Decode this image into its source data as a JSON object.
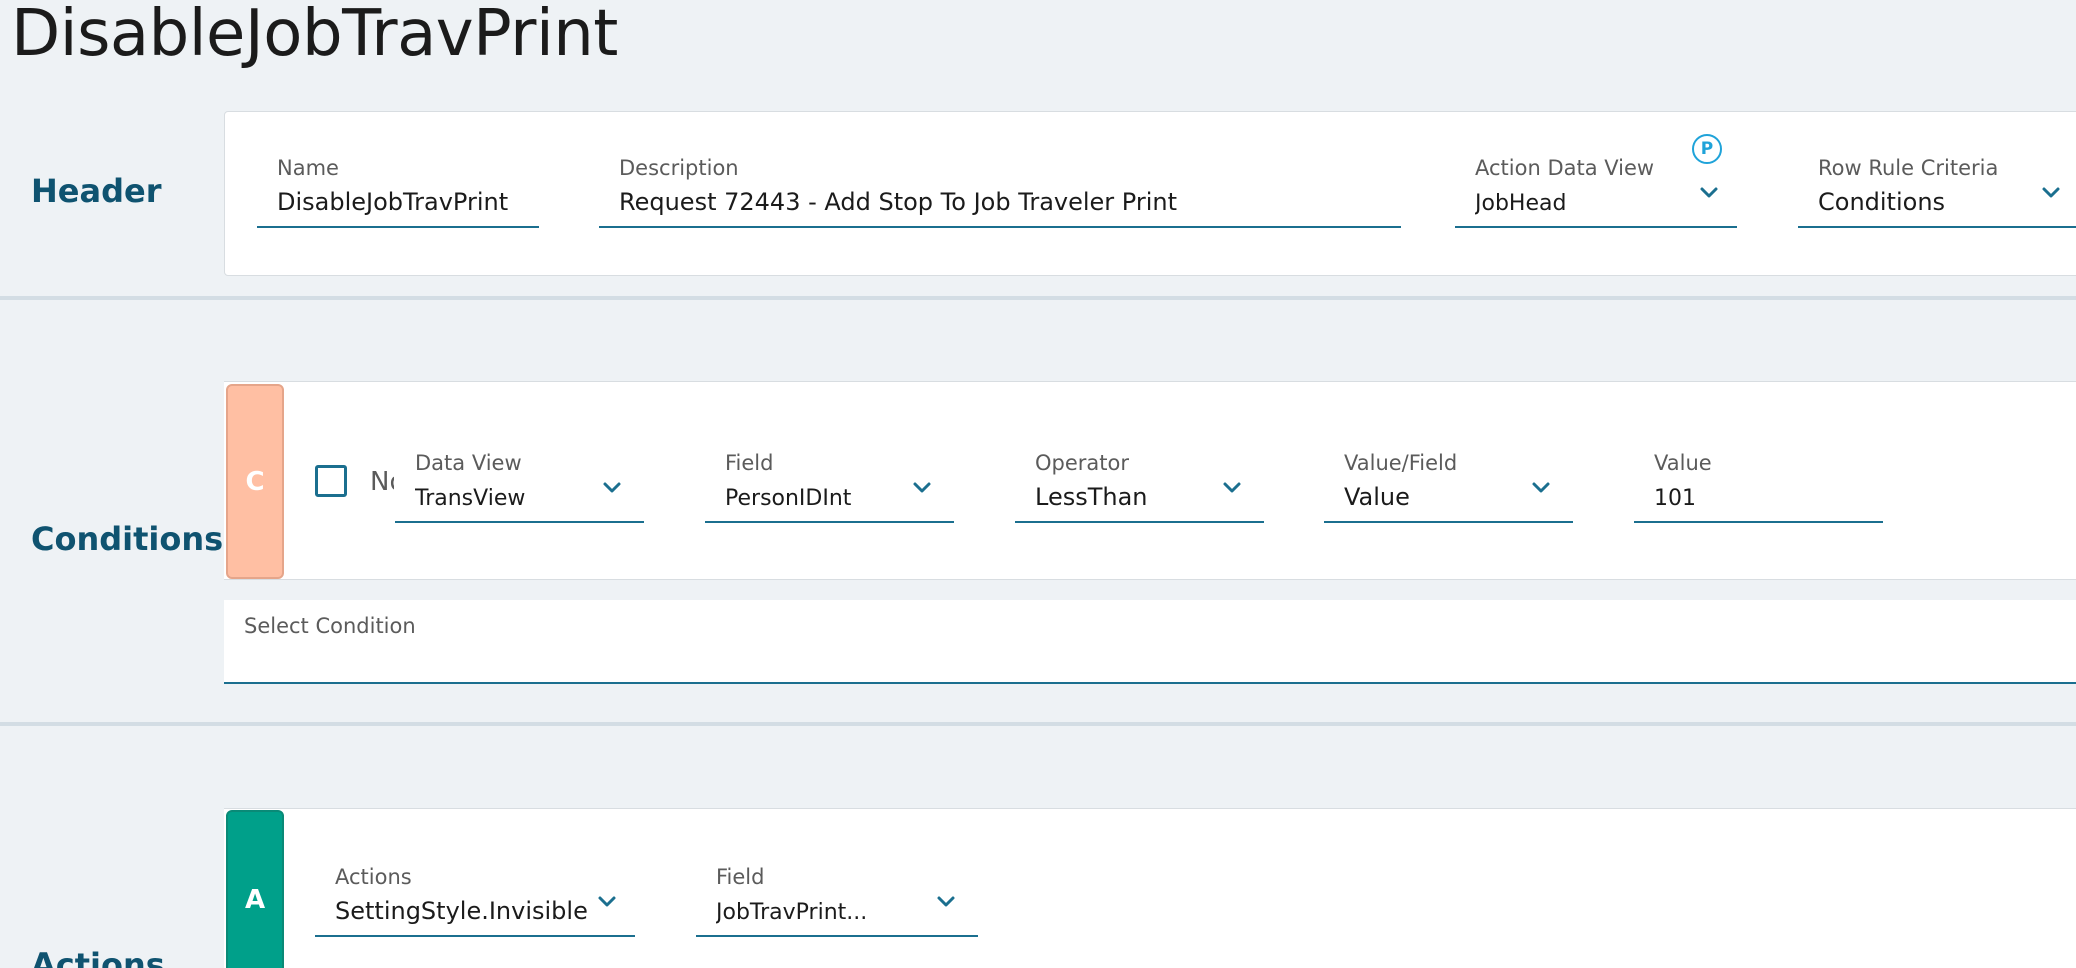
{
  "page_title": "DisableJobTravPrint",
  "sections": {
    "header": "Header",
    "conditions": "Conditions",
    "actions": "Actions"
  },
  "header_fields": {
    "name": {
      "label": "Name",
      "value": "DisableJobTravPrint"
    },
    "description": {
      "label": "Description",
      "value": "Request 72443 - Add Stop To Job Traveler Print"
    },
    "action_data_view": {
      "label": "Action Data View",
      "value": "JobHead",
      "badge": "P"
    },
    "row_rule_criteria": {
      "label": "Row Rule Criteria",
      "value": "Conditions"
    }
  },
  "condition_row": {
    "tag": "C",
    "not_label": "Not",
    "data_view": {
      "label": "Data View",
      "value": "TransView"
    },
    "field": {
      "label": "Field",
      "value": "PersonIDInt"
    },
    "operator": {
      "label": "Operator",
      "value": "LessThan"
    },
    "value_field": {
      "label": "Value/Field",
      "value": "Value"
    },
    "value": {
      "label": "Value",
      "value": "101"
    }
  },
  "select_condition": {
    "label": "Select Condition"
  },
  "action_row": {
    "tag": "A",
    "actions": {
      "label": "Actions",
      "value": "SettingStyle.Invisible"
    },
    "field": {
      "label": "Field",
      "value": "JobTravPrint..."
    }
  },
  "colors": {
    "accent": "#1b6f8f",
    "section_label": "#0f5370",
    "condition_tag": "#ffbfa3",
    "action_tag": "#00a08a",
    "background": "#eef2f5"
  }
}
